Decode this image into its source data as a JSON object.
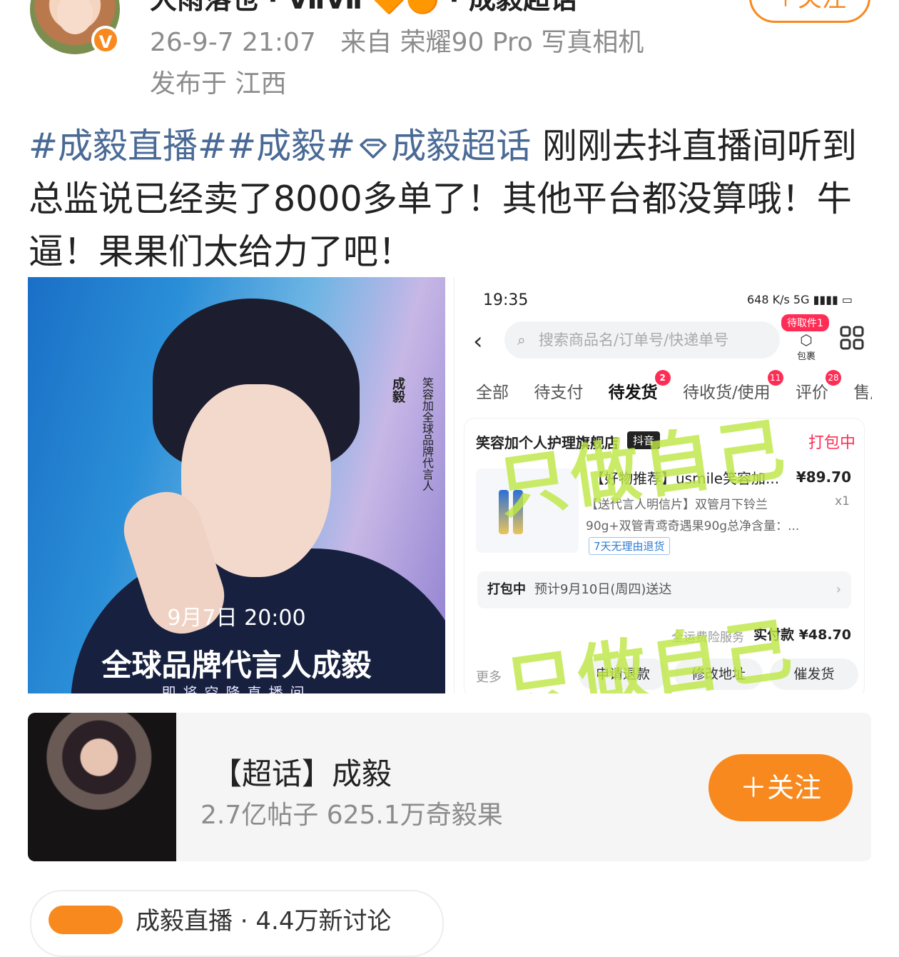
{
  "header": {
    "username": "大雨落也 · ⅦⅦ 🔶🟠 · 成毅超话",
    "verified_badge": "V",
    "follow_label": "＋关注",
    "timestamp": "26-9-7 21:07",
    "source": "来自 荣耀90 Pro 写真相机",
    "location": "发布于 江西"
  },
  "post": {
    "tag1": "#成毅直播#",
    "tag2": "#成毅#",
    "supertopic_tag": "成毅超话",
    "text": " 刚刚去抖直播间听到总监说已经卖了8000多单了！其他平台都没算哦！牛逼！果果们太给力了吧！"
  },
  "poster": {
    "name": "成毅",
    "vertical_title": "笑容加全球品牌代言人",
    "time": "9月7日  20:00",
    "title": "全球品牌代言人成毅",
    "subtitle": "即将空降直播间"
  },
  "order_screenshot": {
    "status_time": "19:35",
    "status_right": "648 K/s 5G ▮▮▮▮ ▭",
    "search_placeholder": "搜索商品名/订单号/快递单号",
    "pending_pickup": "待取件1",
    "package_label": "包裹",
    "tabs": [
      {
        "label": "全部",
        "badge": ""
      },
      {
        "label": "待支付",
        "badge": ""
      },
      {
        "label": "待发货",
        "badge": "2"
      },
      {
        "label": "待收货/使用",
        "badge": "11"
      },
      {
        "label": "评价",
        "badge": "28"
      },
      {
        "label": "售后",
        "badge": ""
      }
    ],
    "shop_name": "笑容加个人护理旗舰店",
    "shop_badge": "抖音",
    "order_status": "打包中",
    "product_title": "【好物推荐】usmile笑容加...",
    "price": "¥89.70",
    "desc_line1": "【送代言人明信片】双管月下铃兰",
    "desc_line2": "90g+双管青鸢奇遇果90g总净含量：...",
    "quantity": "x1",
    "return_policy": "7天无理由退货",
    "shipping_status": "打包中",
    "shipping_eta": "预计9月10日(周四)送达",
    "service_label": "全运费险服务",
    "paid_label": "实付款 ¥48.70",
    "more_label": "更多",
    "buttons": [
      "申请退款",
      "修改地址",
      "催发货"
    ],
    "watermark": "只做自己"
  },
  "topic_card": {
    "title": "【超话】成毅",
    "stats": "2.7亿帖子 625.1万奇毅果",
    "follow_label": "＋关注"
  },
  "bottom": {
    "text": "成毅直播 · 4.4万新讨论"
  },
  "colors": {
    "accent": "#f7891e",
    "hashtag": "#4a6a96",
    "muted": "#8c8c8c"
  }
}
